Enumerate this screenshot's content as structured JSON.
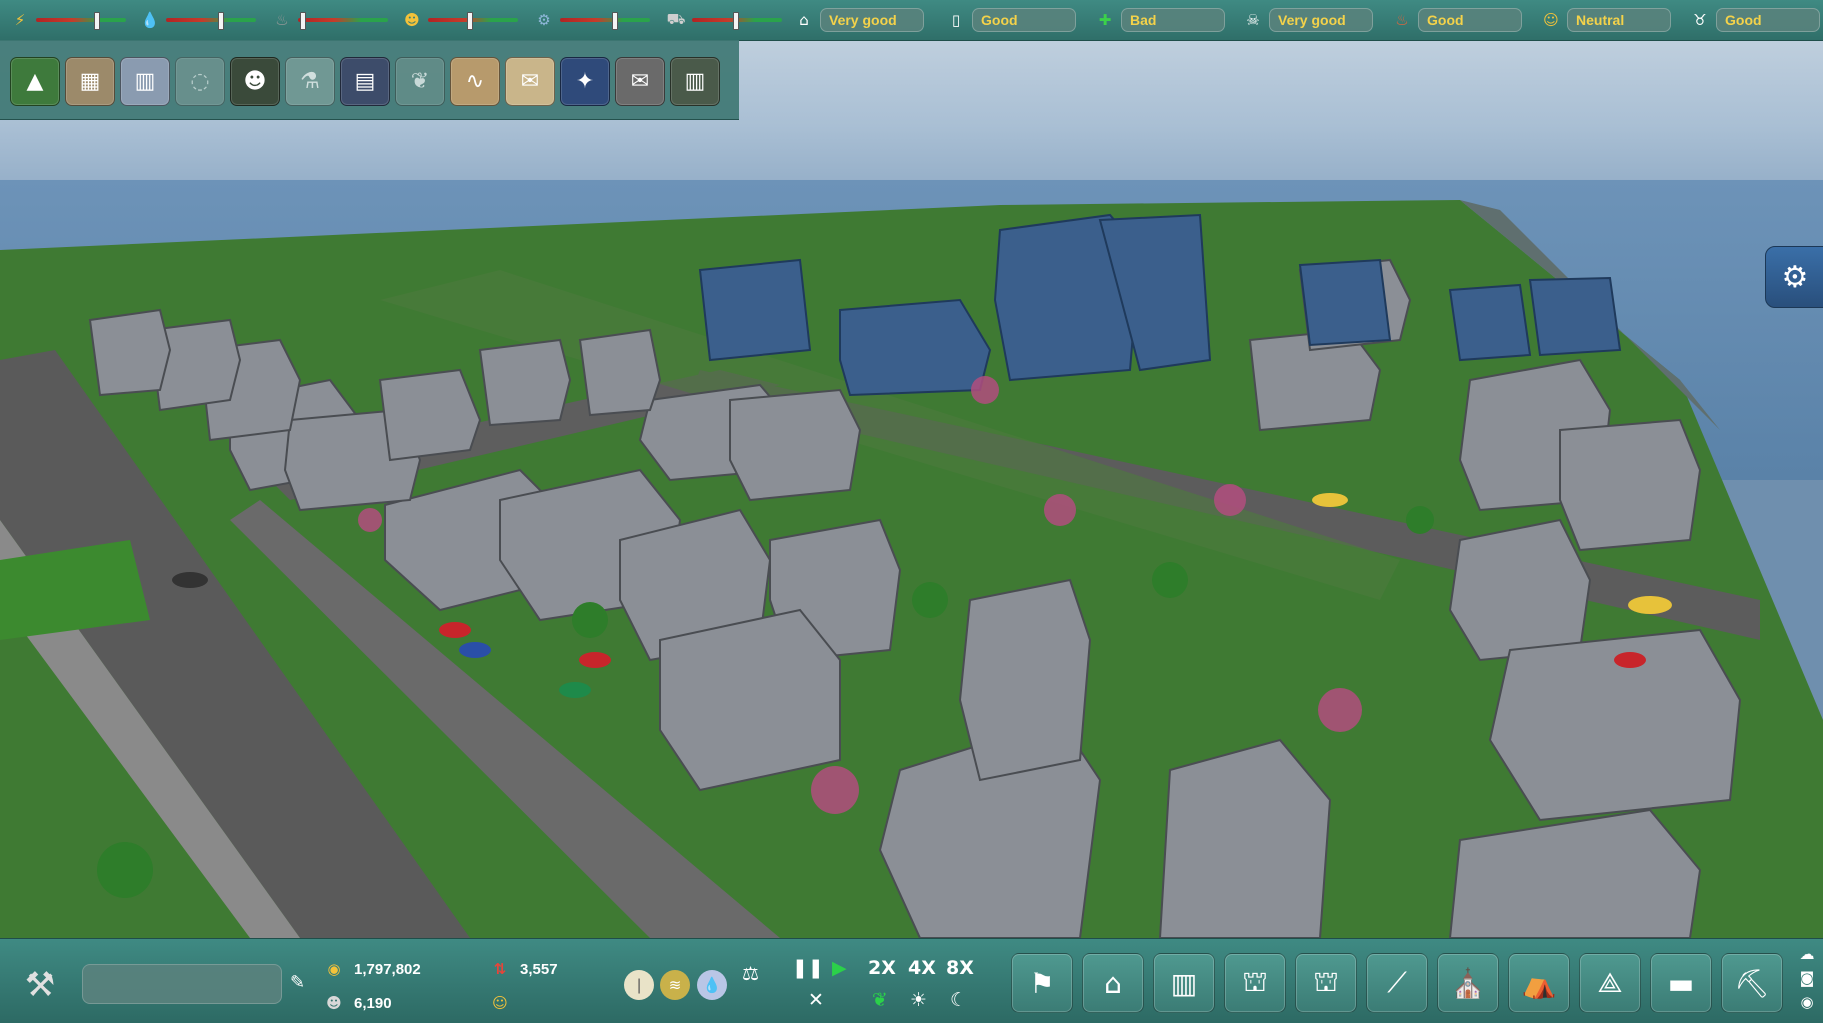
{
  "indicators": [
    {
      "id": "electricity",
      "icon": "lightning-icon",
      "glyph": "⚡",
      "color": "#f3c23a",
      "level": 0.68
    },
    {
      "id": "water",
      "icon": "water-drop-icon",
      "glyph": "💧",
      "color": "#56a8e8",
      "level": 0.6
    },
    {
      "id": "waste",
      "icon": "trash-bag-icon",
      "glyph": "♨",
      "color": "#9a9a9a",
      "level": 0.02
    },
    {
      "id": "workers",
      "icon": "worker-icon",
      "glyph": "☻",
      "color": "#f3c23a",
      "level": 0.45
    },
    {
      "id": "sewage",
      "icon": "sewage-icon",
      "glyph": "⚙",
      "color": "#8fb7d9",
      "level": 0.6
    },
    {
      "id": "transport",
      "icon": "vehicle-icon",
      "glyph": "⛟",
      "color": "#cfcfcf",
      "level": 0.48
    }
  ],
  "ratings": [
    {
      "id": "housing",
      "icon": "house-icon",
      "glyph": "⌂",
      "label": "Very good"
    },
    {
      "id": "education",
      "icon": "book-icon",
      "glyph": "▯",
      "label": "Good"
    },
    {
      "id": "health",
      "icon": "health-cross-icon",
      "glyph": "✚",
      "label": "Bad"
    },
    {
      "id": "safety",
      "icon": "skull-icon",
      "glyph": "☠",
      "label": "Very good"
    },
    {
      "id": "fire",
      "icon": "fire-icon",
      "glyph": "♨",
      "label": "Good"
    },
    {
      "id": "entertainment",
      "icon": "theater-masks-icon",
      "glyph": "☺",
      "label": "Neutral"
    },
    {
      "id": "pollution",
      "icon": "cow-icon",
      "glyph": "♉",
      "label": "Good"
    }
  ],
  "categories": [
    {
      "id": "terrain",
      "icon": "terrain-icon",
      "glyph": "▲",
      "bg": "#3e7a3c"
    },
    {
      "id": "storage",
      "icon": "crates-icon",
      "glyph": "▦",
      "bg": "#9c8a6a"
    },
    {
      "id": "industry",
      "icon": "industry-icon",
      "glyph": "▥",
      "bg": "#8a9bb0"
    },
    {
      "id": "disabled",
      "icon": "disabled-category-icon",
      "glyph": "◌",
      "bg": "#7c9a97"
    },
    {
      "id": "workers",
      "icon": "workers-group-icon",
      "glyph": "☻",
      "bg": "#3a4a3a"
    },
    {
      "id": "research",
      "icon": "flask-icon",
      "glyph": "⚗",
      "bg": "#7ea19d"
    },
    {
      "id": "solar",
      "icon": "solar-panel-icon",
      "glyph": "▤",
      "bg": "#3d4c6a"
    },
    {
      "id": "nature",
      "icon": "leaf-icon",
      "glyph": "❦",
      "bg": "#6a918c"
    },
    {
      "id": "landscape",
      "icon": "landscape-icon",
      "glyph": "∿",
      "bg": "#b79a6c"
    },
    {
      "id": "documents",
      "icon": "scroll-icon",
      "glyph": "✉",
      "bg": "#c9b58a"
    },
    {
      "id": "satellite",
      "icon": "satellite-icon",
      "glyph": "✦",
      "bg": "#2f4a7a"
    },
    {
      "id": "envelope",
      "icon": "envelope-icon",
      "glyph": "✉",
      "bg": "#6a6a6a"
    },
    {
      "id": "library",
      "icon": "books-icon",
      "glyph": "▥",
      "bg": "#4a5a4a"
    }
  ],
  "bottom": {
    "city_name_value": "",
    "money": "1,797,802",
    "population": "6,190",
    "growth": "3,557",
    "tools_icon": "tools-icon",
    "speed_2x": "2X",
    "speed_4x": "4X",
    "speed_8x": "8X"
  },
  "buildings": [
    {
      "id": "wind",
      "icon": "wind-turbine-icon",
      "glyph": "⚑"
    },
    {
      "id": "residential",
      "icon": "residential-icon",
      "glyph": "⌂"
    },
    {
      "id": "commercial",
      "icon": "commercial-icon",
      "glyph": "▥"
    },
    {
      "id": "factory",
      "icon": "factory-icon",
      "glyph": "⛫"
    },
    {
      "id": "plant",
      "icon": "power-plant-icon",
      "glyph": "⛫"
    },
    {
      "id": "road",
      "icon": "road-icon",
      "glyph": "⟋"
    },
    {
      "id": "civic",
      "icon": "capitol-icon",
      "glyph": "⛪"
    },
    {
      "id": "service",
      "icon": "service-icon",
      "glyph": "⛺"
    },
    {
      "id": "structure",
      "icon": "structure-icon",
      "glyph": "⟁"
    },
    {
      "id": "blocks",
      "icon": "blocks-icon",
      "glyph": "▬"
    },
    {
      "id": "crane",
      "icon": "crane-icon",
      "glyph": "⛏"
    }
  ]
}
